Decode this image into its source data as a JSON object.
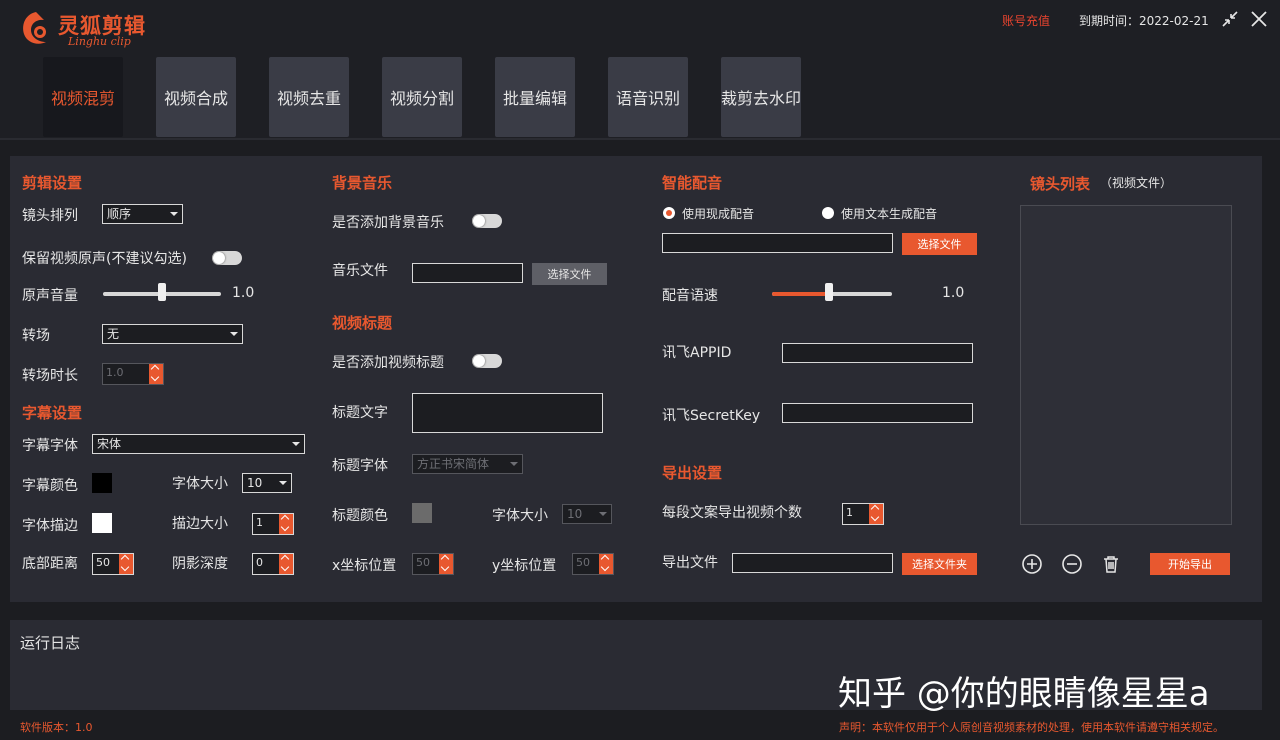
{
  "app": {
    "title": "灵狐剪辑",
    "subtitle": "Linghu clip",
    "recharge": "账号充值",
    "expire": "到期时间：2022-02-21",
    "accent": "#e8582f"
  },
  "nav": {
    "tabs": [
      {
        "label": "视频混剪",
        "active": true
      },
      {
        "label": "视频合成"
      },
      {
        "label": "视频去重"
      },
      {
        "label": "视频分割"
      },
      {
        "label": "批量编辑"
      },
      {
        "label": "语音识别"
      },
      {
        "label": "裁剪去水印"
      }
    ]
  },
  "edit": {
    "title": "剪辑设置",
    "order_label": "镜头排列",
    "order_value": "顺序",
    "keep_audio_label": "保留视频原声(不建议勾选)",
    "keep_audio_on": false,
    "volume_label": "原声音量",
    "volume_value": "1.0",
    "volume_fraction": 0.5,
    "transition_label": "转场",
    "transition_value": "无",
    "transition_duration_label": "转场时长",
    "transition_duration_value": "1.0"
  },
  "subtitle": {
    "title": "字幕设置",
    "font_label": "字幕字体",
    "font_value": "宋体",
    "color_label": "字幕颜色",
    "color": "#000000",
    "size_label": "字体大小",
    "size_value": "10",
    "stroke_label": "字体描边",
    "stroke_color": "#ffffff",
    "stroke_size_label": "描边大小",
    "stroke_size_value": "1",
    "bottom_label": "底部距离",
    "bottom_value": "50",
    "shadow_label": "阴影深度",
    "shadow_value": "0"
  },
  "music": {
    "title": "背景音乐",
    "add_label": "是否添加背景音乐",
    "add_on": false,
    "file_label": "音乐文件",
    "file_value": "",
    "choose_btn": "选择文件"
  },
  "video_title": {
    "title": "视频标题",
    "add_label": "是否添加视频标题",
    "add_on": false,
    "text_label": "标题文字",
    "text_value": "",
    "font_label": "标题字体",
    "font_value": "方正书宋简体",
    "color_label": "标题颜色",
    "color": "#6b6b6b",
    "size_label": "字体大小",
    "size_value": "10",
    "x_label": "x坐标位置",
    "x_value": "50",
    "y_label": "y坐标位置",
    "y_value": "50"
  },
  "dubbing": {
    "title": "智能配音",
    "opt_existing": "使用现成配音",
    "opt_tts": "使用文本生成配音",
    "file_value": "",
    "choose_btn": "选择文件",
    "speed_label": "配音语速",
    "speed_value": "1.0",
    "speed_fraction": 0.5,
    "appid_label": "讯飞APPID",
    "appid_value": "",
    "secret_label": "讯飞SecretKey",
    "secret_value": ""
  },
  "export": {
    "title": "导出设置",
    "count_label": "每段文案导出视频个数",
    "count_value": "1",
    "file_label": "导出文件",
    "file_value": "",
    "choose_btn": "选择文件夹"
  },
  "shots": {
    "title": "镜头列表",
    "hint": "（视频文件）",
    "start_btn": "开始导出"
  },
  "log": {
    "title": "运行日志"
  },
  "watermark": "知乎 @你的眼睛像星星a",
  "footer": {
    "version": "软件版本：1.0",
    "notice": "声明：本软件仅用于个人原创音视频素材的处理，使用本软件请遵守相关规定。"
  }
}
